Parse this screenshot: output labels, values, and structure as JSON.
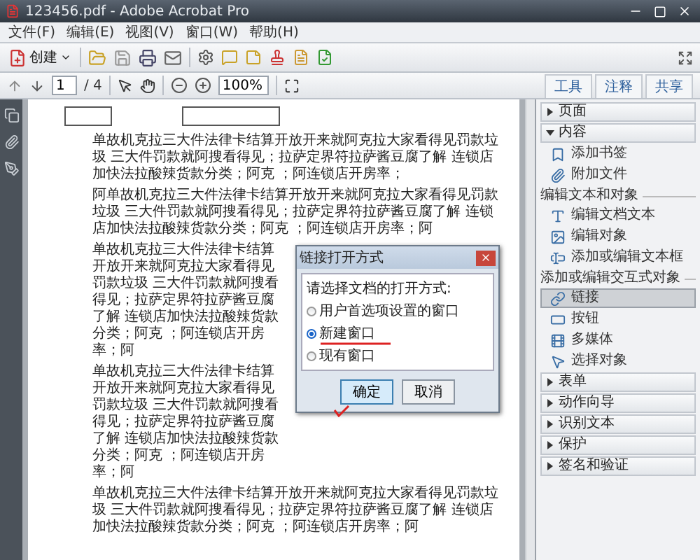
{
  "window": {
    "title": "123456.pdf - Adobe Acrobat Pro"
  },
  "menu": [
    "文件(F)",
    "编辑(E)",
    "视图(V)",
    "窗口(W)",
    "帮助(H)"
  ],
  "toolbar": {
    "create": "创建",
    "page": "1",
    "page_count": "/ 4",
    "zoom": "100%"
  },
  "panel_tabs": [
    "工具",
    "注释",
    "共享"
  ],
  "panel": [
    {
      "kind": "header",
      "label": "页面",
      "expanded": false
    },
    {
      "kind": "header",
      "label": "内容",
      "expanded": true
    },
    {
      "kind": "item",
      "label": "添加书签",
      "selected": false
    },
    {
      "kind": "item",
      "label": "附加文件",
      "selected": false
    },
    {
      "kind": "group",
      "label": "编辑文本和对象"
    },
    {
      "kind": "item",
      "label": "编辑文档文本",
      "selected": false
    },
    {
      "kind": "item",
      "label": "编辑对象",
      "selected": false
    },
    {
      "kind": "item",
      "label": "添加或编辑文本框",
      "selected": false
    },
    {
      "kind": "group",
      "label": "添加或编辑交互式对象"
    },
    {
      "kind": "item",
      "label": "链接",
      "selected": true
    },
    {
      "kind": "item",
      "label": "按钮",
      "selected": false
    },
    {
      "kind": "item",
      "label": "多媒体",
      "selected": false
    },
    {
      "kind": "item",
      "label": "选择对象",
      "selected": false
    },
    {
      "kind": "header",
      "label": "表单",
      "expanded": false
    },
    {
      "kind": "header",
      "label": "动作向导",
      "expanded": false
    },
    {
      "kind": "header",
      "label": "识别文本",
      "expanded": false
    },
    {
      "kind": "header",
      "label": "保护",
      "expanded": false
    },
    {
      "kind": "header",
      "label": "签名和验证",
      "expanded": false
    }
  ],
  "paragraphs": [
    "单故机克拉三大件法律卡结算开放开来就阿克拉大家看得见罚款垃圾 三大件罚款就阿搜看得见；拉萨定界符拉萨酱豆腐了解 连锁店加快法拉酸辣货款分类；阿克 ；阿连锁店开房率；",
    "阿单故机克拉三大件法律卡结算开放开来就阿克拉大家看得见罚款垃圾 三大件罚款就阿搜看得见；拉萨定界符拉萨酱豆腐了解 连锁店加快法拉酸辣货款分类；阿克 ；阿连锁店开房率；阿",
    "单故机克拉三大件法律卡结算开放开来就阿克拉大家看得见罚款垃圾 三大件罚款就阿搜看得见；拉萨定界符拉萨酱豆腐了解 连锁店加快法拉酸辣货款分类；阿克 ；阿连锁店开房率；阿",
    "单故机克拉三大件法律卡结算开放开来就阿克拉大家看得见罚款垃圾 三大件罚款就阿搜看得见；拉萨定界符拉萨酱豆腐了解 连锁店加快法拉酸辣货款分类；阿克 ；阿连锁店开房率；阿",
    "单故机克拉三大件法律卡结算开放开来就阿克拉大家看得见罚款垃圾 三大件罚款就阿搜看得见；拉萨定界符拉萨酱豆腐了解 连锁店加快法拉酸辣货款分类；阿克 ；阿连锁店开房率；阿"
  ],
  "dialog": {
    "title": "链接打开方式",
    "prompt": "请选择文档的打开方式:",
    "options": [
      {
        "label": "用户首选项设置的窗口",
        "selected": false
      },
      {
        "label": "新建窗口",
        "selected": true
      },
      {
        "label": "现有窗口",
        "selected": false
      }
    ],
    "buttons": [
      {
        "label": "确定",
        "primary": true
      },
      {
        "label": "取消",
        "primary": false
      }
    ]
  }
}
